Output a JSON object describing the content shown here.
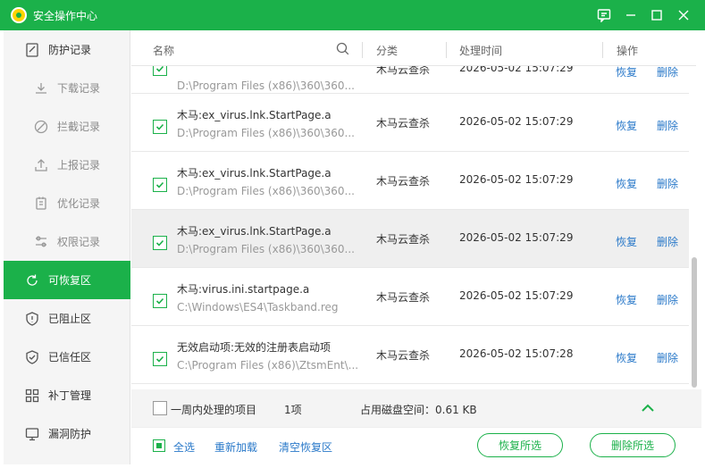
{
  "window": {
    "title": "安全操作中心",
    "controls": [
      "feedback-icon",
      "minimize-icon",
      "maximize-icon",
      "close-icon"
    ]
  },
  "sidebar": {
    "items": [
      {
        "label": "防护记录",
        "icon": "record-icon",
        "sub": false,
        "active": false
      },
      {
        "label": "下载记录",
        "icon": "download-icon",
        "sub": true,
        "active": false
      },
      {
        "label": "拦截记录",
        "icon": "block-icon",
        "sub": true,
        "active": false
      },
      {
        "label": "上报记录",
        "icon": "upload-icon",
        "sub": true,
        "active": false
      },
      {
        "label": "优化记录",
        "icon": "optimize-icon",
        "sub": true,
        "active": false
      },
      {
        "label": "权限记录",
        "icon": "permission-icon",
        "sub": true,
        "active": false
      },
      {
        "label": "可恢复区",
        "icon": "restore-icon",
        "sub": false,
        "active": true
      },
      {
        "label": "已阻止区",
        "icon": "shield-block-icon",
        "sub": false,
        "active": false
      },
      {
        "label": "已信任区",
        "icon": "shield-check-icon",
        "sub": false,
        "active": false
      },
      {
        "label": "补丁管理",
        "icon": "patch-icon",
        "sub": false,
        "active": false
      },
      {
        "label": "漏洞防护",
        "icon": "vulnerability-icon",
        "sub": false,
        "active": false
      }
    ]
  },
  "table": {
    "headers": {
      "name": "名称",
      "category": "分类",
      "time": "处理时间",
      "action": "操作"
    },
    "rows": [
      {
        "name": "",
        "path": "D:\\Program Files (x86)\\360\\360...",
        "category": "木马云查杀",
        "time": "2026-05-02 15:07:29",
        "restore": "恢复",
        "delete": "删除",
        "highlight": false
      },
      {
        "name": "木马:ex_virus.lnk.StartPage.a",
        "path": "D:\\Program Files (x86)\\360\\360...",
        "category": "木马云查杀",
        "time": "2026-05-02 15:07:29",
        "restore": "恢复",
        "delete": "删除",
        "highlight": false
      },
      {
        "name": "木马:ex_virus.lnk.StartPage.a",
        "path": "D:\\Program Files (x86)\\360\\360...",
        "category": "木马云查杀",
        "time": "2026-05-02 15:07:29",
        "restore": "恢复",
        "delete": "删除",
        "highlight": false
      },
      {
        "name": "木马:ex_virus.lnk.StartPage.a",
        "path": "D:\\Program Files (x86)\\360\\360...",
        "category": "木马云查杀",
        "time": "2026-05-02 15:07:29",
        "restore": "恢复",
        "delete": "删除",
        "highlight": true
      },
      {
        "name": "木马:virus.ini.startpage.a",
        "path": "C:\\Windows\\ES4\\Taskband.reg",
        "category": "木马云查杀",
        "time": "2026-05-02 15:07:29",
        "restore": "恢复",
        "delete": "删除",
        "highlight": false
      },
      {
        "name": "无效启动项:无效的注册表启动项",
        "path": "C:\\Program Files (x86)\\ZtsmEnt\\...",
        "category": "木马云查杀",
        "time": "2026-05-02 15:07:28",
        "restore": "恢复",
        "delete": "删除",
        "highlight": false
      }
    ]
  },
  "summary": {
    "label": "一周内处理的项目",
    "count": "1项",
    "disk_space": "占用磁盘空间：0.61 KB"
  },
  "footer": {
    "select_all": "全选",
    "reload": "重新加载",
    "clear": "清空恢复区",
    "restore_selected": "恢复所选",
    "delete_selected": "删除所选"
  },
  "colors": {
    "accent": "#1bb14a",
    "link": "#2a79c9"
  }
}
